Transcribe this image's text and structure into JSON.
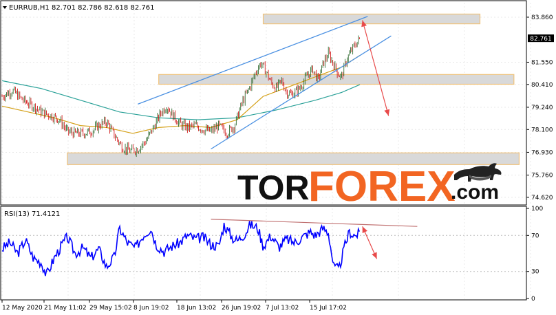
{
  "header": {
    "symbol_line": "EURRUB,H1  82.701 82.786 82.618 82.761",
    "rsi_line": "RSI(13) 71.4121"
  },
  "logo": {
    "part1": "TOR",
    "part2": "FOREX",
    "part3": ".com"
  },
  "colors": {
    "bull_candle": "#1a5c1a",
    "bear_candle": "#cc0000",
    "ma_fast": "#d4a017",
    "ma_slow": "#2aa198",
    "trendline": "#4a90e2",
    "zone_fill": "#d9d9d9",
    "zone_border": "#f0c27a",
    "arrow": "#e84a4a",
    "rsi_line": "#0000ff",
    "rsi_div_line": "#c07070",
    "grid": "#e8e8e8"
  },
  "chart_data": [
    {
      "type": "candlestick",
      "symbol": "EURRUB",
      "timeframe": "H1",
      "ohlc_last": {
        "open": 82.701,
        "high": 82.786,
        "low": 82.618,
        "close": 82.761
      },
      "current_price_label": "82.761",
      "ylim": [
        74.3,
        84.6
      ],
      "y_ticks": [
        {
          "value": 83.86,
          "label": "83.860"
        },
        {
          "value": 81.55,
          "label": "81.550"
        },
        {
          "value": 80.41,
          "label": "80.410"
        },
        {
          "value": 79.24,
          "label": "79.240"
        },
        {
          "value": 78.1,
          "label": "78.100"
        },
        {
          "value": 76.93,
          "label": "76.930"
        },
        {
          "value": 75.76,
          "label": "75.760"
        },
        {
          "value": 74.62,
          "label": "74.620"
        }
      ],
      "x_ticks": [
        "12 May 2020",
        "21 May 11:02",
        "29 May 15:02",
        "8 Jun 19:02",
        "18 Jun 13:02",
        "26 Jun 19:02",
        "7 Jul 13:02",
        "15 Jul 17:02"
      ],
      "close_path": [
        [
          0,
          79.8
        ],
        [
          8,
          80.1
        ],
        [
          16,
          79.6
        ],
        [
          24,
          79.3
        ],
        [
          30,
          79.0
        ],
        [
          38,
          78.8
        ],
        [
          44,
          78.6
        ],
        [
          50,
          78.0
        ],
        [
          56,
          77.9
        ],
        [
          62,
          77.9
        ],
        [
          68,
          78.0
        ],
        [
          74,
          78.3
        ],
        [
          80,
          78.5
        ],
        [
          86,
          77.8
        ],
        [
          92,
          77.2
        ],
        [
          98,
          77.0
        ],
        [
          104,
          77.1
        ],
        [
          110,
          77.5
        ],
        [
          116,
          78.2
        ],
        [
          122,
          79.0
        ],
        [
          126,
          79.3
        ],
        [
          130,
          78.9
        ],
        [
          136,
          78.4
        ],
        [
          142,
          78.2
        ],
        [
          148,
          78.3
        ],
        [
          154,
          78.1
        ],
        [
          160,
          78.0
        ],
        [
          166,
          78.3
        ],
        [
          172,
          77.9
        ],
        [
          178,
          78.3
        ],
        [
          184,
          79.5
        ],
        [
          190,
          80.3
        ],
        [
          194,
          81.0
        ],
        [
          198,
          81.5
        ],
        [
          202,
          81.1
        ],
        [
          206,
          80.5
        ],
        [
          210,
          80.2
        ],
        [
          214,
          80.6
        ],
        [
          218,
          80.0
        ],
        [
          222,
          79.9
        ],
        [
          228,
          80.2
        ],
        [
          234,
          80.9
        ],
        [
          238,
          81.2
        ],
        [
          242,
          80.6
        ],
        [
          246,
          81.5
        ],
        [
          250,
          82.0
        ],
        [
          254,
          81.4
        ],
        [
          258,
          80.9
        ],
        [
          260,
          80.8
        ],
        [
          264,
          81.7
        ],
        [
          268,
          82.2
        ],
        [
          272,
          82.6
        ],
        [
          274,
          82.761
        ]
      ],
      "ma_fast_path": [
        [
          0,
          79.3
        ],
        [
          20,
          79.0
        ],
        [
          40,
          78.7
        ],
        [
          60,
          78.3
        ],
        [
          80,
          78.2
        ],
        [
          100,
          77.9
        ],
        [
          120,
          78.2
        ],
        [
          140,
          78.3
        ],
        [
          160,
          78.2
        ],
        [
          180,
          78.6
        ],
        [
          200,
          79.8
        ],
        [
          220,
          80.3
        ],
        [
          240,
          80.8
        ],
        [
          260,
          81.3
        ],
        [
          274,
          81.9
        ]
      ],
      "ma_slow_path": [
        [
          0,
          80.6
        ],
        [
          30,
          80.2
        ],
        [
          60,
          79.6
        ],
        [
          90,
          79.0
        ],
        [
          120,
          78.7
        ],
        [
          150,
          78.6
        ],
        [
          180,
          78.7
        ],
        [
          210,
          79.1
        ],
        [
          240,
          79.6
        ],
        [
          260,
          80.0
        ],
        [
          274,
          80.4
        ]
      ],
      "resistance_zones": [
        {
          "x_from": 200,
          "x_to": 366,
          "y_from": 83.52,
          "y_to": 84.02
        },
        {
          "x_from": 120,
          "x_to": 392,
          "y_from": 80.42,
          "y_to": 80.92
        },
        {
          "x_from": 50,
          "x_to": 396,
          "y_from": 76.3,
          "y_to": 76.9
        }
      ],
      "trend_lines": [
        {
          "from": [
            104,
            79.4
          ],
          "to": [
            280,
            83.9
          ]
        },
        {
          "from": [
            160,
            77.1
          ],
          "to": [
            298,
            82.9
          ]
        }
      ],
      "projection_arrows": [
        {
          "from": [
            276,
            83.7
          ],
          "to": [
            296,
            78.8
          ]
        }
      ]
    },
    {
      "type": "line",
      "indicator": "RSI(13)",
      "current_value": 71.4121,
      "ylim": [
        0,
        100
      ],
      "y_ticks": [
        {
          "value": 100,
          "label": "100"
        },
        {
          "value": 70,
          "label": "70"
        },
        {
          "value": 30,
          "label": "30"
        },
        {
          "value": 0,
          "label": "0"
        }
      ],
      "path": [
        [
          0,
          55
        ],
        [
          6,
          62
        ],
        [
          12,
          50
        ],
        [
          18,
          65
        ],
        [
          24,
          45
        ],
        [
          30,
          40
        ],
        [
          34,
          26
        ],
        [
          40,
          45
        ],
        [
          46,
          60
        ],
        [
          50,
          68
        ],
        [
          56,
          50
        ],
        [
          62,
          56
        ],
        [
          68,
          45
        ],
        [
          74,
          55
        ],
        [
          80,
          35
        ],
        [
          86,
          46
        ],
        [
          90,
          78
        ],
        [
          96,
          62
        ],
        [
          102,
          56
        ],
        [
          108,
          70
        ],
        [
          114,
          78
        ],
        [
          118,
          60
        ],
        [
          124,
          52
        ],
        [
          130,
          58
        ],
        [
          136,
          62
        ],
        [
          142,
          70
        ],
        [
          148,
          66
        ],
        [
          154,
          68
        ],
        [
          160,
          60
        ],
        [
          166,
          58
        ],
        [
          170,
          82
        ],
        [
          176,
          68
        ],
        [
          180,
          64
        ],
        [
          186,
          72
        ],
        [
          190,
          82
        ],
        [
          196,
          78
        ],
        [
          200,
          58
        ],
        [
          206,
          70
        ],
        [
          212,
          57
        ],
        [
          218,
          66
        ],
        [
          224,
          62
        ],
        [
          230,
          68
        ],
        [
          236,
          74
        ],
        [
          240,
          70
        ],
        [
          246,
          78
        ],
        [
          250,
          73
        ],
        [
          254,
          35
        ],
        [
          258,
          32
        ],
        [
          262,
          56
        ],
        [
          266,
          74
        ],
        [
          270,
          70
        ],
        [
          274,
          72
        ]
      ],
      "divergence_line": {
        "from": [
          160,
          88
        ],
        "to": [
          318,
          80
        ]
      },
      "projection_arrows": [
        {
          "from": [
            276,
            80
          ],
          "to": [
            287,
            44
          ]
        }
      ]
    }
  ]
}
